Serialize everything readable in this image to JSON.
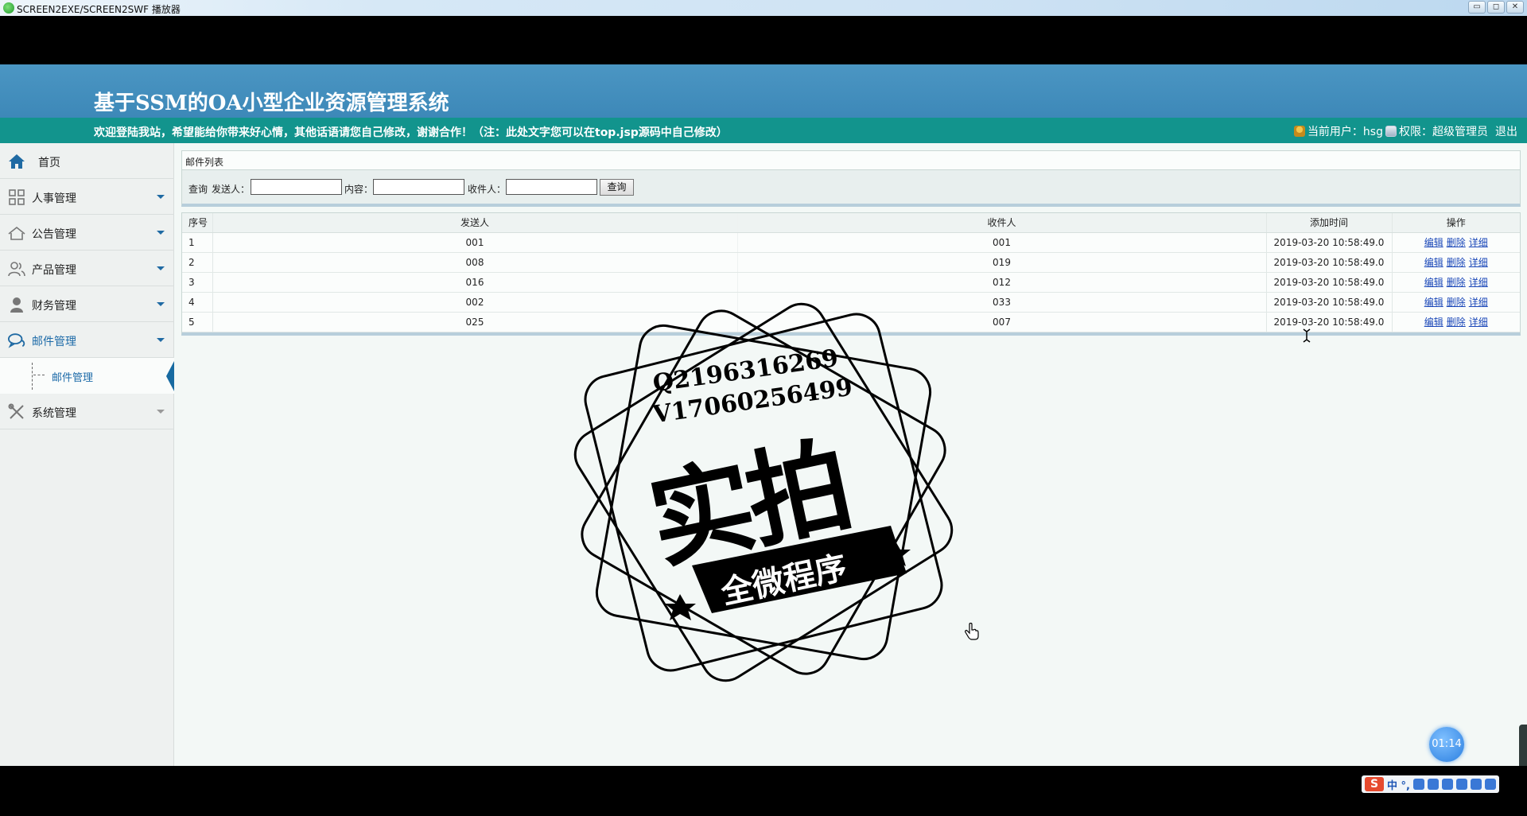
{
  "window": {
    "title": "SCREEN2EXE/SCREEN2SWF 播放器",
    "buttons": [
      "▭",
      "◻",
      "✕"
    ]
  },
  "header": {
    "site_title": "基于SSM的OA小型企业资源管理系统",
    "welcome": "欢迎登陆我站，希望能给你带来好心情，其他话语请您自己修改，谢谢合作！（注：此处文字您可以在top.jsp源码中自己修改）",
    "current_user_label": "当前用户：hsg",
    "role_label": "权限：超级管理员",
    "logout": "退出"
  },
  "sidebar": {
    "items": [
      {
        "label": "首页",
        "icon": "home-icon"
      },
      {
        "label": "人事管理",
        "icon": "grid-icon"
      },
      {
        "label": "公告管理",
        "icon": "house-icon"
      },
      {
        "label": "产品管理",
        "icon": "users-icon"
      },
      {
        "label": "财务管理",
        "icon": "person-icon"
      },
      {
        "label": "邮件管理",
        "icon": "chat-icon"
      },
      {
        "label": "系统管理",
        "icon": "tools-icon"
      }
    ],
    "submenu": {
      "label": "邮件管理"
    }
  },
  "content": {
    "panel_title": "邮件列表",
    "search": {
      "query_label": "查询",
      "sender_label": "发送人：",
      "content_label": "内容：",
      "receiver_label": "收件人：",
      "button": "查询",
      "sender_value": "",
      "content_value": "",
      "receiver_value": ""
    },
    "table": {
      "headers": [
        "序号",
        "发送人",
        "收件人",
        "添加时间",
        "操作"
      ],
      "rows": [
        {
          "no": "1",
          "sender": "001",
          "receiver": "001",
          "time": "2019-03-20 10:58:49.0"
        },
        {
          "no": "2",
          "sender": "008",
          "receiver": "019",
          "time": "2019-03-20 10:58:49.0"
        },
        {
          "no": "3",
          "sender": "016",
          "receiver": "012",
          "time": "2019-03-20 10:58:49.0"
        },
        {
          "no": "4",
          "sender": "002",
          "receiver": "033",
          "time": "2019-03-20 10:58:49.0"
        },
        {
          "no": "5",
          "sender": "025",
          "receiver": "007",
          "time": "2019-03-20 10:58:49.0"
        }
      ],
      "ops": [
        "编辑",
        "删除",
        "详细"
      ]
    }
  },
  "watermark": {
    "line1": "Q2196316269",
    "line2": "V17060256499",
    "big": "实拍",
    "ribbon": "全微程序"
  },
  "timer": "01:14",
  "ime": {
    "logo": "S",
    "text": "中 °,"
  },
  "colors": {
    "header_blue": "#3d88b8",
    "welcome_teal": "#12948d",
    "link_blue": "#1a47b8",
    "accent": "#176aa1"
  }
}
